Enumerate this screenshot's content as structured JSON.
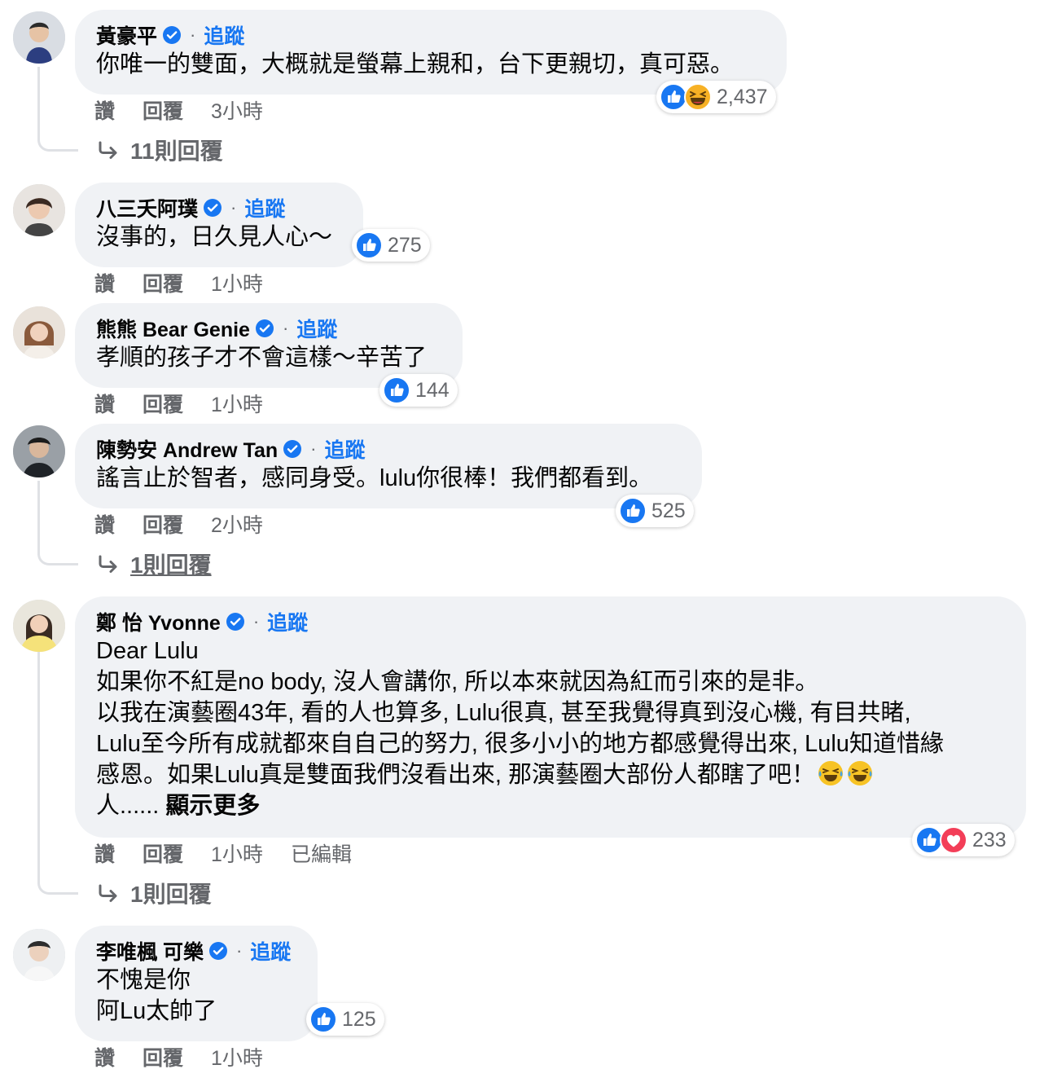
{
  "comments": [
    {
      "name": "黃豪平",
      "follow": "追蹤",
      "lines": [
        "你唯一的雙面，大概就是螢幕上親和，台下更親切，真可惡。"
      ],
      "reactions": [
        "like",
        "haha"
      ],
      "reaction_count": "2,437",
      "like": "讚",
      "reply": "回覆",
      "time": "3小時",
      "replies": "11則回覆"
    },
    {
      "name": "八三夭阿璞",
      "follow": "追蹤",
      "lines": [
        "沒事的，日久見人心～"
      ],
      "reactions": [
        "like"
      ],
      "reaction_count": "275",
      "like": "讚",
      "reply": "回覆",
      "time": "1小時"
    },
    {
      "name": "熊熊 Bear Genie",
      "follow": "追蹤",
      "lines": [
        "孝順的孩子才不會這樣～辛苦了"
      ],
      "reactions": [
        "like"
      ],
      "reaction_count": "144",
      "like": "讚",
      "reply": "回覆",
      "time": "1小時"
    },
    {
      "name": "陳勢安 Andrew Tan",
      "follow": "追蹤",
      "lines": [
        "謠言止於智者，感同身受。lulu你很棒！我們都看到。"
      ],
      "reactions": [
        "like"
      ],
      "reaction_count": "525",
      "like": "讚",
      "reply": "回覆",
      "time": "2小時",
      "replies": "1則回覆"
    },
    {
      "name": "鄭 怡 Yvonne",
      "follow": "追蹤",
      "lines": [
        "Dear Lulu",
        "如果你不紅是no body, 沒人會講你, 所以本來就因為紅而引來的是非。",
        "以我在演藝圈43年, 看的人也算多, Lulu很真, 甚至我覺得真到沒心機, 有目共睹,",
        "Lulu至今所有成就都來自自己的努力, 很多小小的地方都感覺得出來, Lulu知道惜緣",
        "感恩。如果Lulu真是雙面我們沒看出來, 那演藝圈大部份人都瞎了吧！",
        "人......"
      ],
      "see_more": "顯示更多",
      "reactions": [
        "like",
        "love"
      ],
      "reaction_count": "233",
      "like": "讚",
      "reply": "回覆",
      "time": "1小時",
      "edited": "已編輯",
      "replies": "1則回覆"
    },
    {
      "name": "李唯楓 可樂",
      "follow": "追蹤",
      "lines": [
        "不愧是你",
        "阿Lu太帥了"
      ],
      "reactions": [
        "like"
      ],
      "reaction_count": "125",
      "like": "讚",
      "reply": "回覆",
      "time": "1小時"
    }
  ]
}
